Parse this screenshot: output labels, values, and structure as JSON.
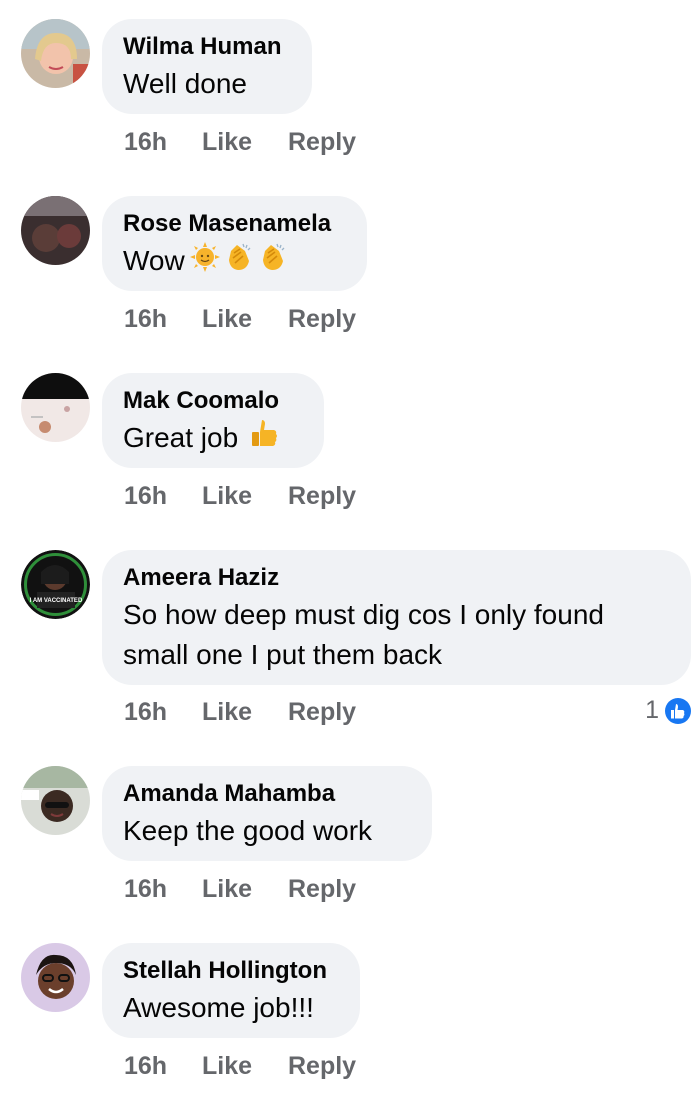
{
  "comments": [
    {
      "author": "Wilma Human",
      "text": "Well done",
      "time": "16h",
      "like": "Like",
      "reply": "Reply"
    },
    {
      "author": "Rose Masenamela",
      "text": "Wow",
      "time": "16h",
      "like": "Like",
      "reply": "Reply",
      "emoji": [
        "sun-face-icon",
        "clapping-hands-icon",
        "clapping-hands-icon"
      ]
    },
    {
      "author": "Mak Coomalo",
      "text": "Great job",
      "time": "16h",
      "like": "Like",
      "reply": "Reply",
      "emoji": [
        "thumbs-up-icon"
      ]
    },
    {
      "author": "Ameera Haziz",
      "text_line1": "So how deep must dig cos I only found",
      "text_line2": "small one I put them back",
      "time": "16h",
      "like": "Like",
      "reply": "Reply",
      "reaction_count": "1"
    },
    {
      "author": "Amanda Mahamba",
      "text": "Keep the good work",
      "time": "16h",
      "like": "Like",
      "reply": "Reply"
    },
    {
      "author": "Stellah Hollington",
      "text": "Awesome job!!!",
      "time": "16h",
      "like": "Like",
      "reply": "Reply"
    }
  ],
  "avatar_text": {
    "ameera": "I AM VACCINATED"
  },
  "colors": {
    "bubble": "#f0f2f5",
    "meta": "#65676b",
    "like_blue": "#1877f2"
  }
}
